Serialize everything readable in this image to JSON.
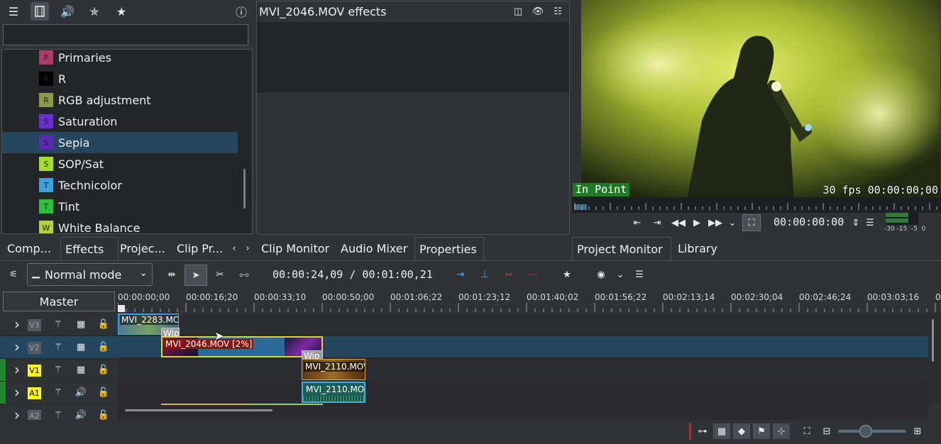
{
  "effects_panel": {
    "search_placeholder": "",
    "items": [
      {
        "letter": "P",
        "label": "Primaries",
        "color": "#b03a6e"
      },
      {
        "letter": "R",
        "label": "R",
        "color": "#000000"
      },
      {
        "letter": "R",
        "label": "RGB adjustment",
        "color": "#8e9a4a"
      },
      {
        "letter": "S",
        "label": "Saturation",
        "color": "#6a2fd4"
      },
      {
        "letter": "S",
        "label": "Sepia",
        "color": "#5a2ab0"
      },
      {
        "letter": "S",
        "label": "SOP/Sat",
        "color": "#a6e01e"
      },
      {
        "letter": "T",
        "label": "Technicolor",
        "color": "#3aa0e0"
      },
      {
        "letter": "T",
        "label": "Tint",
        "color": "#29c23a"
      },
      {
        "letter": "W",
        "label": "White Balance",
        "color": "#b0d43a"
      }
    ],
    "selected_index": 4
  },
  "effect_stack": {
    "title": "MVI_2046.MOV effects"
  },
  "monitor": {
    "in_point": "In Point",
    "fps_timecode": "30 fps 00:00:00;00",
    "timecode": "00:00:00:00",
    "meter_labels": "-30 -15  -5  0"
  },
  "tabs_left": [
    {
      "label": "Comp..."
    },
    {
      "label": "Effects"
    },
    {
      "label": "Projec..."
    },
    {
      "label": "Clip Pr..."
    }
  ],
  "tabs_mid": [
    {
      "label": "Clip Monitor"
    },
    {
      "label": "Audio Mixer"
    },
    {
      "label": "Properties"
    }
  ],
  "tabs_right": [
    {
      "label": "Project Monitor"
    },
    {
      "label": "Library"
    }
  ],
  "timeline_toolbar": {
    "mode": "Normal mode",
    "timecode": "00:00:24,09 / 00:01:00,21"
  },
  "ruler": {
    "master": "Master",
    "labels": [
      "00:00:00;00",
      "00:00:16;20",
      "00:00:33;10",
      "00:00:50;00",
      "00:01:06;22",
      "00:01:23;12",
      "00:01:40;02",
      "00:01:56;22",
      "00:02:13;14",
      "00:02:30;04",
      "00:02:46;24",
      "00:03:03;16",
      "0"
    ]
  },
  "tracks": [
    {
      "name": "V3",
      "badge_bg": "#555a60",
      "badge_fg": "#9aa0a6",
      "type": "video"
    },
    {
      "name": "V2",
      "badge_bg": "#555a60",
      "badge_fg": "#9aa0a6",
      "type": "video"
    },
    {
      "name": "V1",
      "badge_bg": "#ffff00",
      "badge_fg": "#000000",
      "type": "video"
    },
    {
      "name": "A1",
      "badge_bg": "#ffff00",
      "badge_fg": "#000000",
      "type": "audio"
    },
    {
      "name": "A2",
      "badge_bg": "#555a60",
      "badge_fg": "#9aa0a6",
      "type": "audio"
    }
  ],
  "clips": {
    "c1": "MVI_2283.MO",
    "c2": "MVI_2046.MOV [2%]",
    "c3": "MVI_2110.MOV",
    "c4": "MVI_2110.MOV",
    "wipe1": "Wip",
    "wipe2": "Wip"
  },
  "colors": {
    "accent": "#3daee9",
    "selection": "#24475f",
    "dock_bg": "#2f3337"
  }
}
